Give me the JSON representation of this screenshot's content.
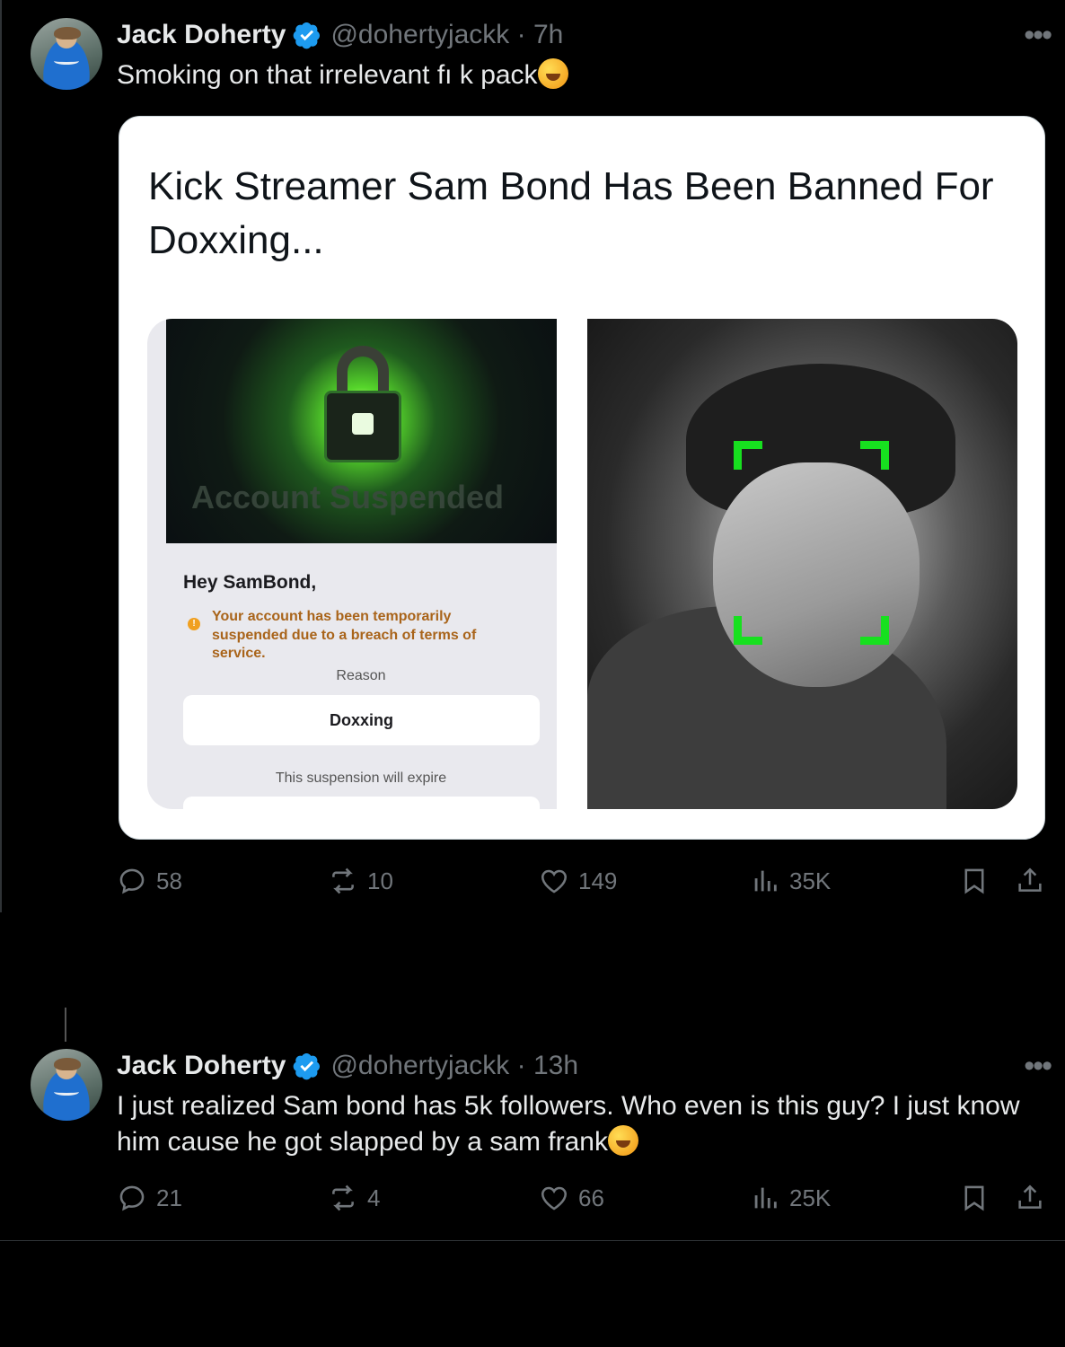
{
  "tweets": [
    {
      "name": "Jack Doherty",
      "handle": "@dohertyjackk",
      "time": "7h",
      "text": "Smoking on that irrelevant fı   k pack",
      "card": {
        "title": "Kick Streamer Sam Bond Has Been Banned For Doxxing...",
        "suspension_screen": {
          "banner_text": "Account Suspended",
          "greeting": "Hey SamBond,",
          "notice": "Your account has been temporarily suspended due to a breach of terms of service.",
          "reason_label": "Reason",
          "reason": "Doxxing",
          "expire_label": "This suspension will expire"
        }
      },
      "stats": {
        "replies": "58",
        "reposts": "10",
        "likes": "149",
        "views": "35K"
      }
    },
    {
      "name": "Jack Doherty",
      "handle": "@dohertyjackk",
      "time": "13h",
      "text": "I just realized Sam bond has 5k followers. Who even is this guy? I just know him cause he got slapped by a sam frank",
      "stats": {
        "replies": "21",
        "reposts": "4",
        "likes": "66",
        "views": "25K"
      }
    }
  ],
  "icons": {
    "verified": "verified-badge-icon",
    "more": "more-options-icon",
    "reply": "reply-icon",
    "repost": "repost-icon",
    "like": "heart-icon",
    "views": "views-icon",
    "bookmark": "bookmark-icon",
    "share": "share-icon"
  },
  "colors": {
    "background": "#000000",
    "text": "#e7e9ea",
    "muted": "#71767b",
    "verified": "#1d9bf0",
    "face_scan": "#17e01f"
  }
}
